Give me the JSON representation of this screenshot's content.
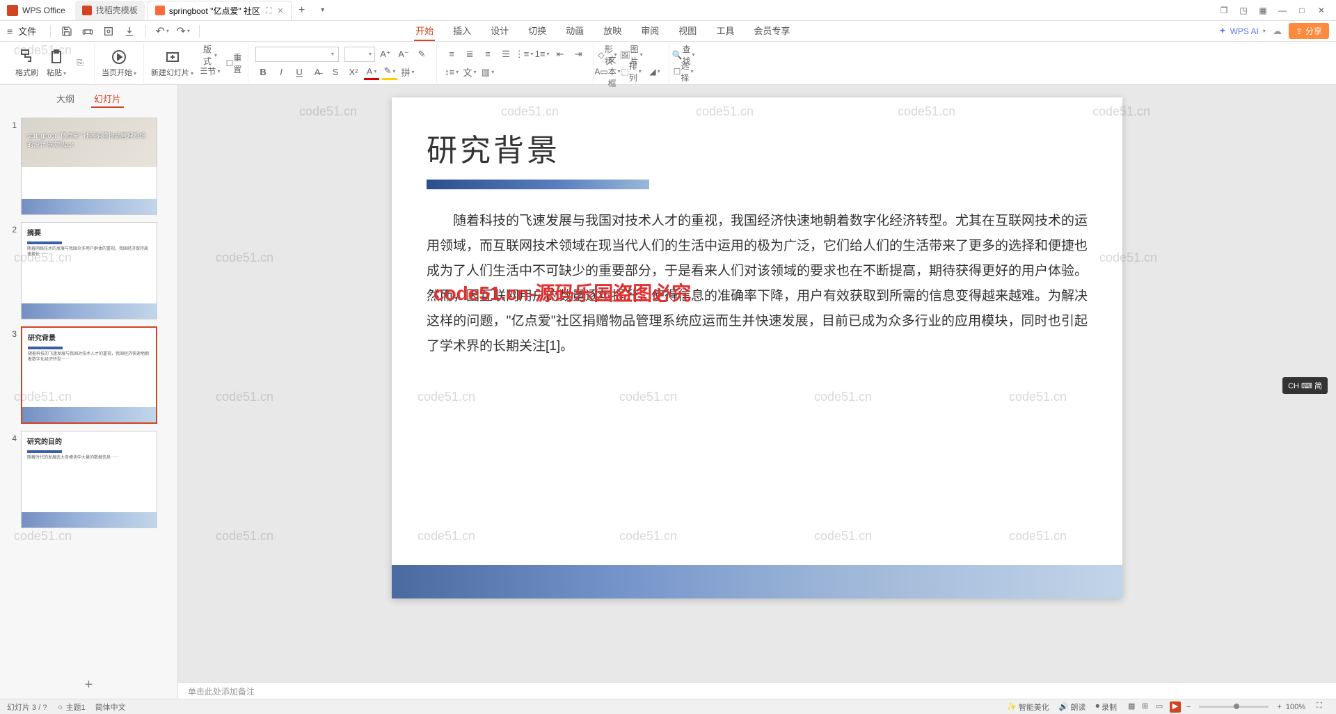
{
  "app": {
    "name": "WPS Office"
  },
  "tabs": {
    "template_tab": "找稻壳模板",
    "active_tab": "springboot \"亿点爱\" 社区",
    "add_tab": "+"
  },
  "qat": {
    "file_label": "文件"
  },
  "menu": {
    "items": [
      "开始",
      "插入",
      "设计",
      "切换",
      "动画",
      "放映",
      "审阅",
      "视图",
      "工具",
      "会员专享"
    ],
    "active_index": 0,
    "wps_ai": "WPS AI",
    "share": "分享"
  },
  "ribbon": {
    "format_painter": "格式刷",
    "paste": "粘贴",
    "from_begin": "当页开始",
    "new_slide": "新建幻灯片",
    "layout": "版式",
    "section": "节",
    "reset": "重置",
    "font_name": "",
    "font_size": "",
    "shape": "形状",
    "picture": "图片",
    "textbox": "文本框",
    "arrange": "排列",
    "find": "查找",
    "select": "选择"
  },
  "side_tabs": {
    "outline": "大纲",
    "slides": "幻灯片"
  },
  "thumbs": [
    {
      "num": "1",
      "title": "springboot \"亿点爱\" 社区捐赠物品管理系统的设计与实现ppt"
    },
    {
      "num": "2",
      "title": "摘要"
    },
    {
      "num": "3",
      "title": "研究背景"
    },
    {
      "num": "4",
      "title": "研究的目的"
    }
  ],
  "slide": {
    "title": "研究背景",
    "body": "随着科技的飞速发展与我国对技术人才的重视，我国经济快速地朝着数字化经济转型。尤其在互联网技术的运用领域，而互联网技术领域在现当代人们的生活中运用的极为广泛，它们给人们的生活带来了更多的选择和便捷也成为了人们生活中不可缺少的重要部分，于是看来人们对该领域的要求也在不断提高，期待获得更好的用户体验。然而，因互联网用户的数量逐年提升，使得信息的准确率下降，用户有效获取到所需的信息变得越来越难。为解决这样的问题，\"亿点爱\"社区捐赠物品管理系统应运而生并快速发展，目前已成为众多行业的应用模块，同时也引起了学术界的长期关注[1]。",
    "red_overlay": "code51.cn-源码乐园盗图必究"
  },
  "notes": {
    "placeholder": "单击此处添加备注"
  },
  "status": {
    "slide_pos": "幻灯片 3 / ?",
    "theme": "主题1",
    "lang": "简体中文",
    "smart_beautify": "智能美化",
    "voice_read": "朗读",
    "record": "录制",
    "zoom": "100%"
  },
  "ime": {
    "label": "CH ⌨ 简"
  },
  "watermark": "code51.cn"
}
